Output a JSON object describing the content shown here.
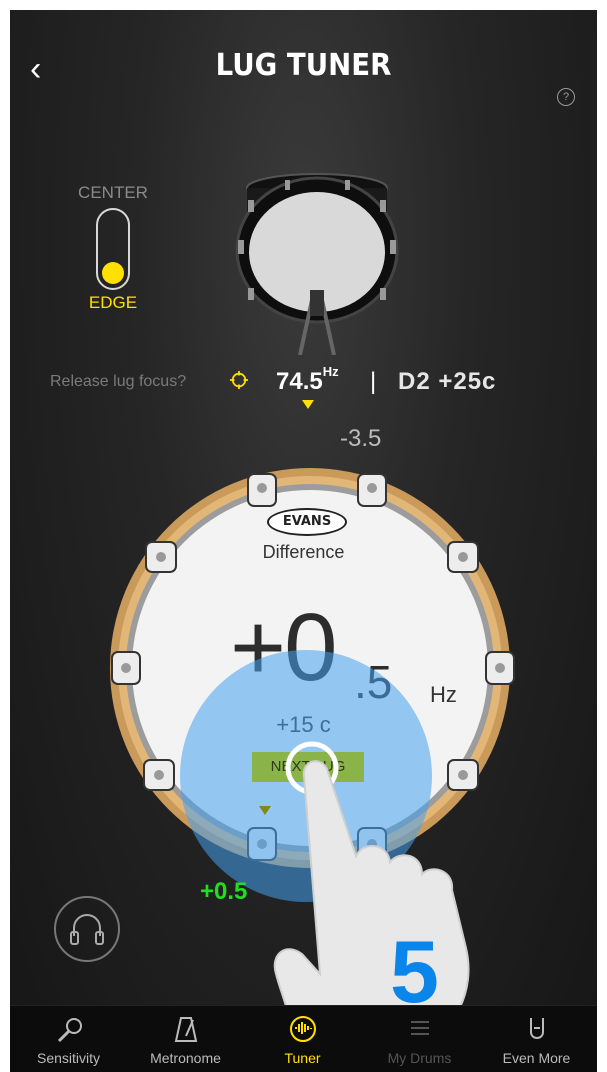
{
  "header": {
    "title": "LUG TUNER",
    "back_icon": "chevron-left-icon",
    "help_label": "?"
  },
  "mode_toggle": {
    "top_label": "CENTER",
    "bottom_label": "EDGE",
    "selected": "EDGE"
  },
  "tuning": {
    "release_label": "Release lug focus?",
    "frequency": "74.5",
    "frequency_unit": "Hz",
    "separator": "|",
    "note": "D2 +25c",
    "top_lug_difference": "-3.5"
  },
  "drum_display": {
    "brand": "EVANS",
    "difference_label": "Difference",
    "value_whole": "+0",
    "value_decimal": ".5",
    "unit": "Hz",
    "cents": "+15 c",
    "next_lug_button": "NEXT LUG",
    "current_lug_difference": "+0.5"
  },
  "tutorial": {
    "step_number": "5"
  },
  "colors": {
    "accent": "#ffe000",
    "positive": "#1ee01e",
    "touch": "#46a0f0",
    "step": "#0a85ea"
  },
  "tabbar": {
    "items": [
      {
        "label": "Sensitivity",
        "icon": "microphone-icon",
        "active": false
      },
      {
        "label": "Metronome",
        "icon": "metronome-icon",
        "active": false
      },
      {
        "label": "Tuner",
        "icon": "tuner-icon",
        "active": true
      },
      {
        "label": "My Drums",
        "icon": "my-drums-icon",
        "active": false
      },
      {
        "label": "Even More",
        "icon": "rock-hand-icon",
        "active": false
      }
    ]
  }
}
